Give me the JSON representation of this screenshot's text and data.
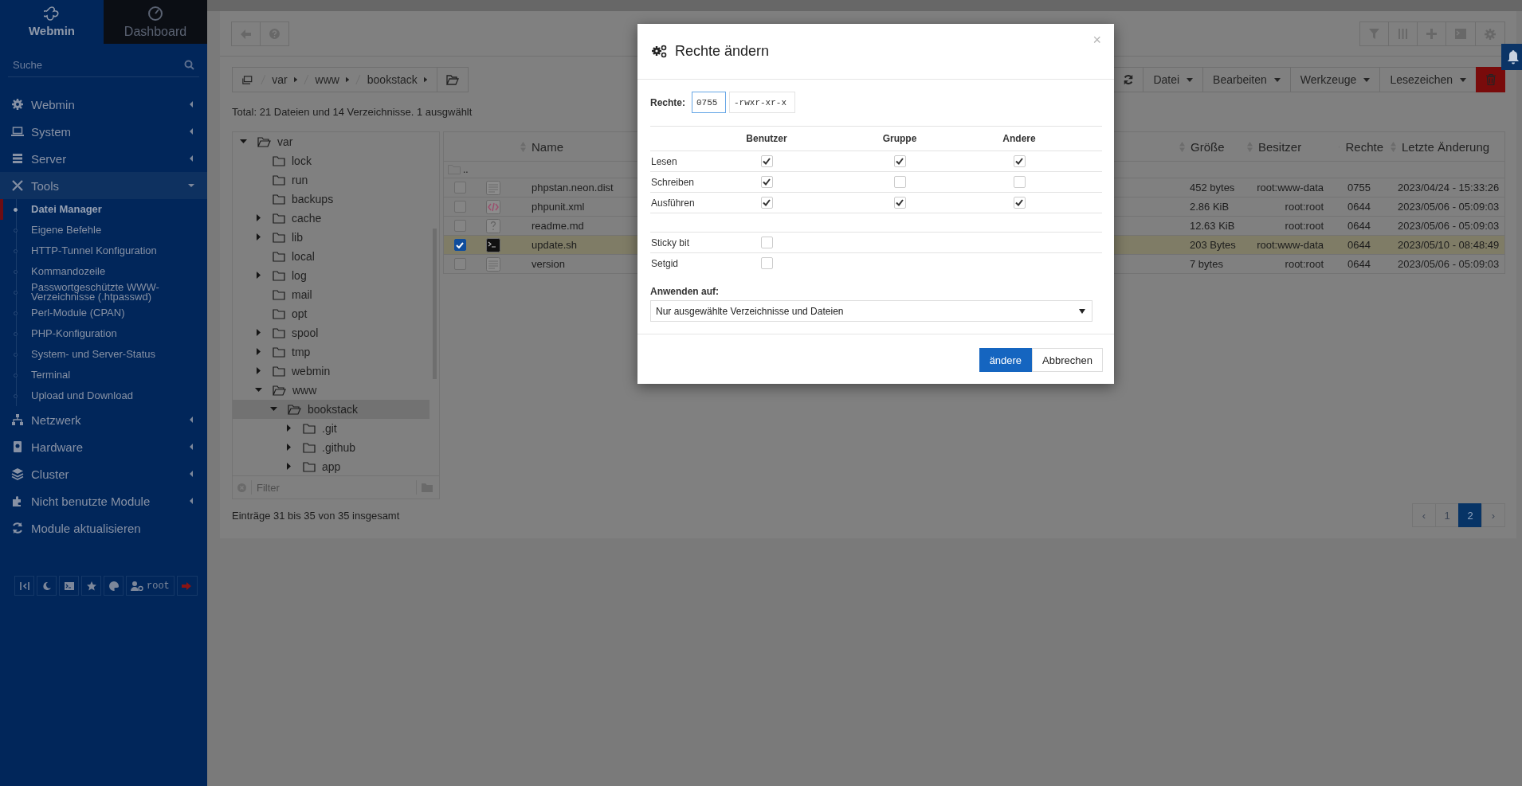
{
  "sidebar": {
    "tabs": [
      {
        "label": "Webmin",
        "selected": true
      },
      {
        "label": "Dashboard",
        "selected": false
      }
    ],
    "search": {
      "placeholder": "Suche"
    },
    "menu": [
      {
        "label": "Webmin",
        "kind": "category",
        "expanded": false
      },
      {
        "label": "System",
        "kind": "category",
        "expanded": false
      },
      {
        "label": "Server",
        "kind": "category",
        "expanded": false
      },
      {
        "label": "Tools",
        "kind": "category",
        "expanded": true,
        "children": [
          {
            "label": "Datei Manager",
            "selected": true
          },
          {
            "label": "Eigene Befehle",
            "selected": false
          },
          {
            "label": "HTTP-Tunnel Konfiguration",
            "selected": false
          },
          {
            "label": "Kommandozeile",
            "selected": false
          },
          {
            "label": "Passwortgeschützte WWW-Verzeichnisse (.htpasswd)",
            "selected": false
          },
          {
            "label": "Perl-Module (CPAN)",
            "selected": false
          },
          {
            "label": "PHP-Konfiguration",
            "selected": false
          },
          {
            "label": "System- und Server-Status",
            "selected": false
          },
          {
            "label": "Terminal",
            "selected": false
          },
          {
            "label": "Upload und Download",
            "selected": false
          }
        ]
      },
      {
        "label": "Netzwerk",
        "kind": "category",
        "expanded": false
      },
      {
        "label": "Hardware",
        "kind": "category",
        "expanded": false
      },
      {
        "label": "Cluster",
        "kind": "category",
        "expanded": false
      },
      {
        "label": "Nicht benutzte Module",
        "kind": "category",
        "expanded": false
      },
      {
        "label": "Module aktualisieren",
        "kind": "action"
      }
    ],
    "user": "root"
  },
  "toolbar": {
    "breadcrumb": [
      "var",
      "www",
      "bookstack"
    ],
    "menus": [
      "Datei",
      "Bearbeiten",
      "Werkzeuge",
      "Lesezeichen"
    ]
  },
  "summary": "Total: 21 Dateien und 14 Verzeichnisse. 1 ausgwählt",
  "tree": {
    "items": [
      {
        "label": "var",
        "expandable": true,
        "expanded": true,
        "selected": false,
        "children": [
          {
            "label": "lock",
            "expandable": false,
            "expanded": false,
            "selected": false
          },
          {
            "label": "run",
            "expandable": false,
            "expanded": false,
            "selected": false
          },
          {
            "label": "backups",
            "expandable": false,
            "expanded": false,
            "selected": false
          },
          {
            "label": "cache",
            "expandable": true,
            "expanded": false,
            "selected": false
          },
          {
            "label": "lib",
            "expandable": true,
            "expanded": false,
            "selected": false
          },
          {
            "label": "local",
            "expandable": false,
            "expanded": false,
            "selected": false
          },
          {
            "label": "log",
            "expandable": true,
            "expanded": false,
            "selected": false
          },
          {
            "label": "mail",
            "expandable": false,
            "expanded": false,
            "selected": false
          },
          {
            "label": "opt",
            "expandable": false,
            "expanded": false,
            "selected": false
          },
          {
            "label": "spool",
            "expandable": true,
            "expanded": false,
            "selected": false
          },
          {
            "label": "tmp",
            "expandable": true,
            "expanded": false,
            "selected": false
          },
          {
            "label": "webmin",
            "expandable": true,
            "expanded": false,
            "selected": false
          },
          {
            "label": "www",
            "expandable": true,
            "expanded": true,
            "selected": false,
            "children": [
              {
                "label": "bookstack",
                "expandable": true,
                "expanded": true,
                "selected": true,
                "children": [
                  {
                    "label": ".git",
                    "expandable": true,
                    "expanded": false,
                    "selected": false
                  },
                  {
                    "label": ".github",
                    "expandable": true,
                    "expanded": false,
                    "selected": false
                  },
                  {
                    "label": "app",
                    "expandable": true,
                    "expanded": false,
                    "selected": false
                  }
                ]
              }
            ]
          }
        ]
      }
    ],
    "filter_placeholder": "Filter"
  },
  "files": {
    "columns": [
      "Name",
      "Größe",
      "Besitzer",
      "Rechte",
      "Letzte Änderung"
    ],
    "parent": "..",
    "rows": [
      {
        "kind": "text",
        "name": "phpstan.neon.dist",
        "size": "452 bytes",
        "owner": "root:www-data",
        "perms": "0755",
        "modified": "2023/04/24 - 15:33:26",
        "selected": false
      },
      {
        "kind": "code",
        "name": "phpunit.xml",
        "size": "2.86 KiB",
        "owner": "root:root",
        "perms": "0644",
        "modified": "2023/05/06 - 05:09:03",
        "selected": false
      },
      {
        "kind": "unknown",
        "name": "readme.md",
        "size": "12.63 KiB",
        "owner": "root:root",
        "perms": "0644",
        "modified": "2023/05/06 - 05:09:03",
        "selected": false
      },
      {
        "kind": "script",
        "name": "update.sh",
        "size": "203 Bytes",
        "owner": "root:www-data",
        "perms": "0644",
        "modified": "2023/05/10 - 08:48:49",
        "selected": true
      },
      {
        "kind": "text",
        "name": "version",
        "size": "7 bytes",
        "owner": "root:root",
        "perms": "0644",
        "modified": "2023/05/06 - 05:09:03",
        "selected": false
      }
    ]
  },
  "footer": {
    "entries": "Einträge 31 bis 35 von 35 insgesamt",
    "prev": "‹",
    "next": "›",
    "pages": [
      {
        "label": "1",
        "selected": false
      },
      {
        "label": "2",
        "selected": true
      }
    ]
  },
  "modal": {
    "title": "Rechte ändern",
    "close": "×",
    "label": "Rechte:",
    "octal": "0755",
    "symbolic": "-rwxr-xr-x",
    "columns": [
      "Benutzer",
      "Gruppe",
      "Andere"
    ],
    "permissions": [
      {
        "label": "Lesen",
        "checks": [
          true,
          true,
          true
        ]
      },
      {
        "label": "Schreiben",
        "checks": [
          true,
          false,
          false
        ]
      },
      {
        "label": "Ausführen",
        "checks": [
          true,
          true,
          true
        ]
      }
    ],
    "special": [
      {
        "label": "Sticky bit",
        "checked": false
      },
      {
        "label": "Setgid",
        "checked": false
      }
    ],
    "apply_label": "Anwenden auf:",
    "apply_value": "Nur ausgewählte Verzeichnisse und Dateien",
    "buttons": [
      {
        "label": "ändere",
        "kind": "primary"
      },
      {
        "label": "Abbrechen",
        "kind": "default"
      }
    ]
  }
}
